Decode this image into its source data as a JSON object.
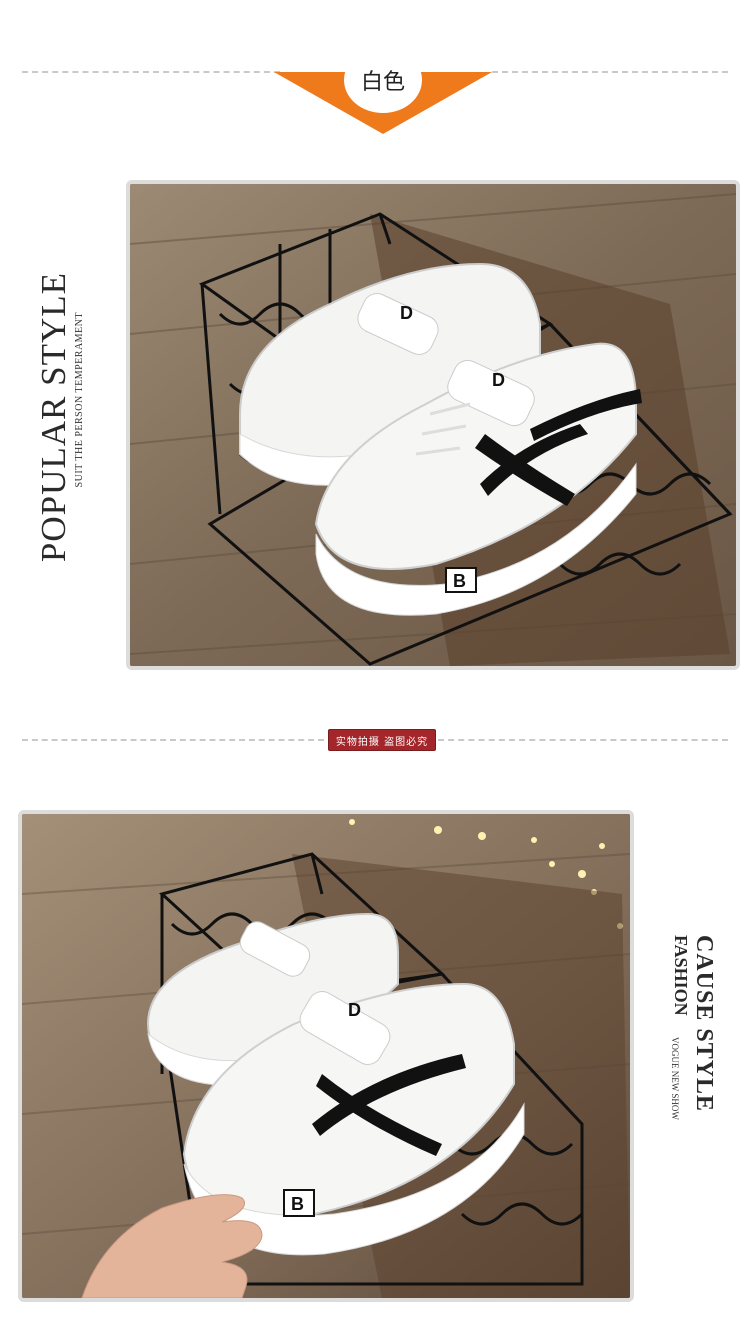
{
  "header": {
    "color_label": "白色",
    "accent_color": "#ee7a1c"
  },
  "section1": {
    "title": "POPULAR STYLE",
    "subtitle": "SUIT THE PERSON TEMPERAMENT"
  },
  "stamp": {
    "text": "实物拍摄 盗图必究"
  },
  "section2": {
    "title": "CAUSE STYLE",
    "line2": "FASHION",
    "subtitle": "VOGUE NEW SHOW"
  },
  "shoe_logo_letter": "B",
  "strap_letter": "D",
  "colors": {
    "stamp": "#a3262a",
    "wood": "#8a7560",
    "shoe": "#f4f4f2",
    "stripe": "#111111"
  }
}
